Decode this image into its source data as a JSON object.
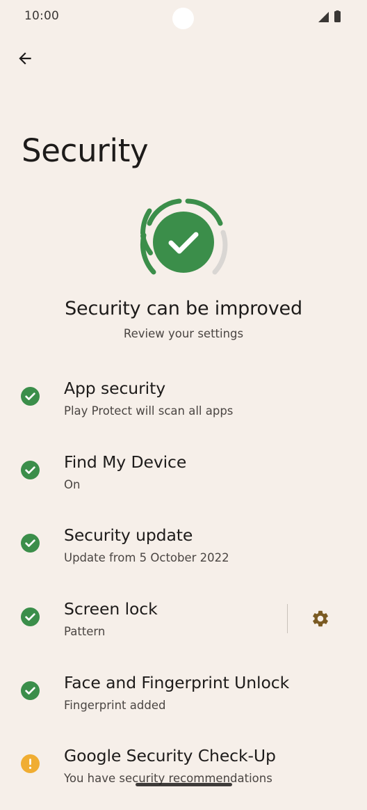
{
  "status_bar": {
    "time": "10:00",
    "icons": [
      "cellular-signal-icon",
      "battery-icon"
    ]
  },
  "toolbar": {
    "back_icon": "arrow-back-icon"
  },
  "page": {
    "title": "Security"
  },
  "summary": {
    "icon": "shield-check-icon",
    "heading": "Security can be improved",
    "subtitle": "Review your settings"
  },
  "items": [
    {
      "title": "App security",
      "subtitle": "Play Protect will scan all apps",
      "status": "ok"
    },
    {
      "title": "Find My Device",
      "subtitle": "On",
      "status": "ok"
    },
    {
      "title": "Security update",
      "subtitle": "Update from 5 October 2022",
      "status": "ok"
    },
    {
      "title": "Screen lock",
      "subtitle": "Pattern",
      "status": "ok",
      "has_settings": true
    },
    {
      "title": "Face and Fingerprint Unlock",
      "subtitle": "Fingerprint added",
      "status": "ok"
    },
    {
      "title": "Google Security Check-Up",
      "subtitle": "You have security recommendations",
      "status": "warning"
    }
  ],
  "colors": {
    "background": "#f6efe9",
    "ok_green": "#3b8e4a",
    "warning_yellow": "#f0ad32",
    "gear_brown": "#7a5a22",
    "ring_inactive": "#d9d6d3"
  }
}
